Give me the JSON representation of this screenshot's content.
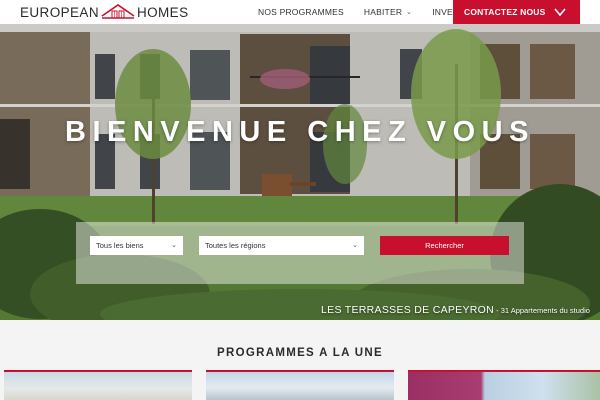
{
  "header": {
    "logo": {
      "word_left": "EUROPEAN",
      "word_right": "HOMES",
      "icon": "house-logo-icon"
    },
    "nav": [
      {
        "label": "NOS PROGRAMMES",
        "has_dropdown": false
      },
      {
        "label": "HABITER",
        "has_dropdown": true
      },
      {
        "label": "INVESTIR",
        "has_dropdown": true
      }
    ],
    "contact_label": "CONTACTEZ NOUS",
    "contact_icon": "chevron-down-icon"
  },
  "hero": {
    "title": "BIENVENUE CHEZ VOUS",
    "search": {
      "type_select": "Tous les biens",
      "region_select": "Toutes les régions",
      "button_label": "Rechercher"
    },
    "caption": {
      "name": "LES TERRASSES DE CAPEYRON",
      "separator": " - ",
      "details": "31 Appartements du studio"
    }
  },
  "programmes": {
    "title": "PROGRAMMES A LA UNE"
  },
  "colors": {
    "accent": "#c8102e",
    "text_dark": "#2b2b2b",
    "section_bg": "#f4f4f4"
  }
}
